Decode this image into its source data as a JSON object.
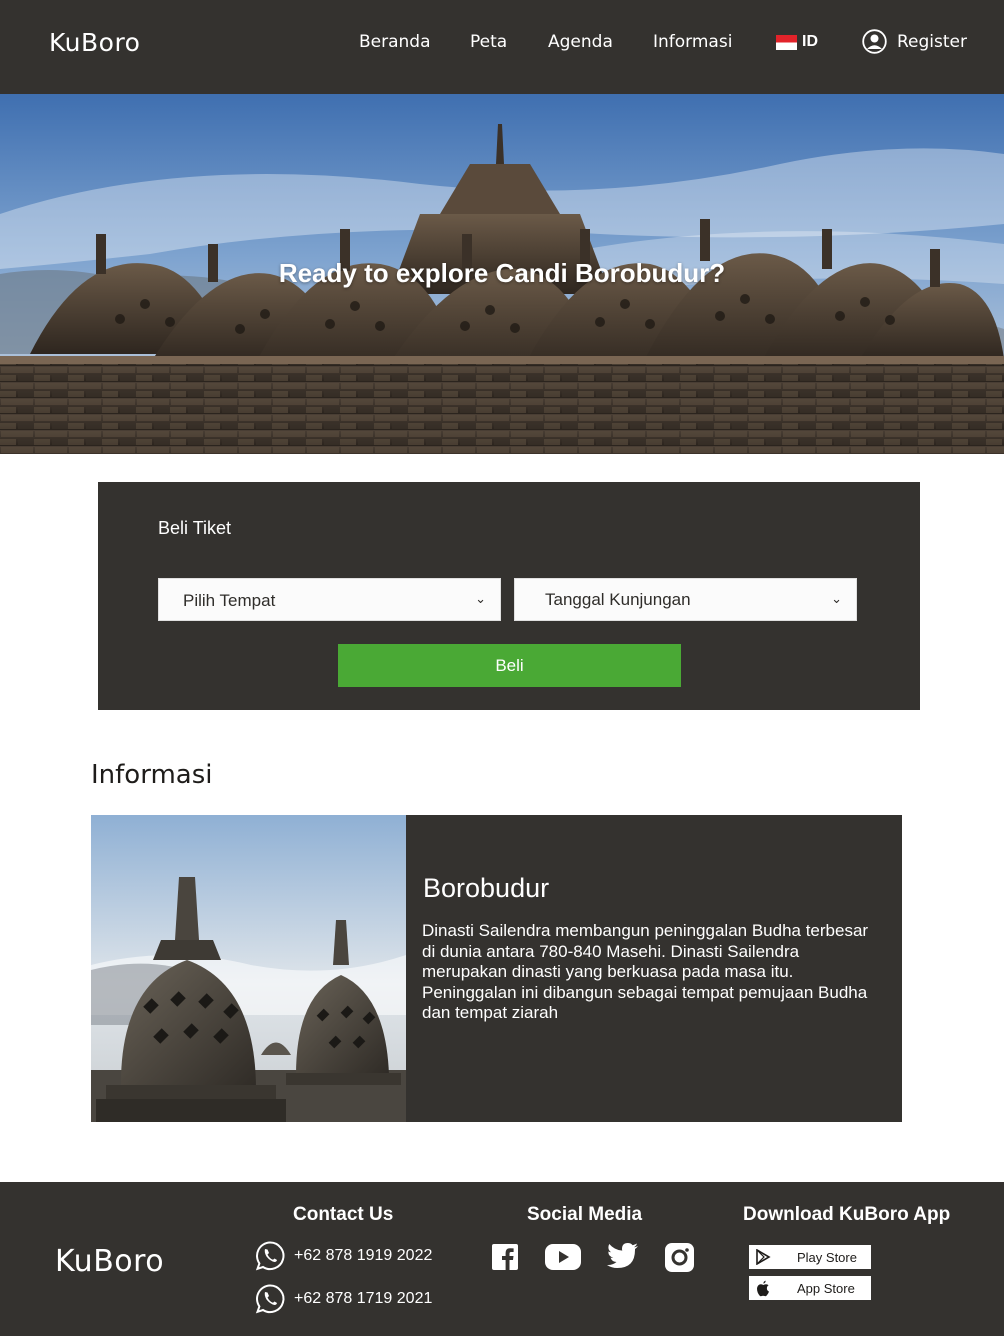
{
  "header": {
    "logo": "KuBoro",
    "nav": [
      "Beranda",
      "Peta",
      "Agenda",
      "Informasi"
    ],
    "lang": "ID",
    "register": "Register"
  },
  "hero": {
    "title": "Ready to explore Candi Borobudur?"
  },
  "ticket": {
    "title": "Beli Tiket",
    "place_select": "Pilih Tempat",
    "date_select": "Tanggal Kunjungan",
    "buy_label": "Beli"
  },
  "info": {
    "section_title": "Informasi",
    "card_title": "Borobudur",
    "card_text": "Dinasti Sailendra membangun peninggalan Budha terbesar di dunia antara 780-840 Masehi. Dinasti Sailendra merupakan dinasti yang berkuasa pada masa itu. Peninggalan ini dibangun sebagai tempat pemujaan Budha dan tempat ziarah"
  },
  "footer": {
    "logo": "KuBoro",
    "contact_heading": "Contact Us",
    "phones": [
      "+62 878 1919 2022",
      "+62 878 1719 2021"
    ],
    "social_heading": "Social Media",
    "socials": [
      "facebook-icon",
      "youtube-icon",
      "twitter-icon",
      "instagram-icon"
    ],
    "download_heading": "Download KuBoro App",
    "stores": [
      "Play Store",
      "App Store"
    ]
  },
  "colors": {
    "dark": "#34322f",
    "accent_green": "#4aa935"
  }
}
